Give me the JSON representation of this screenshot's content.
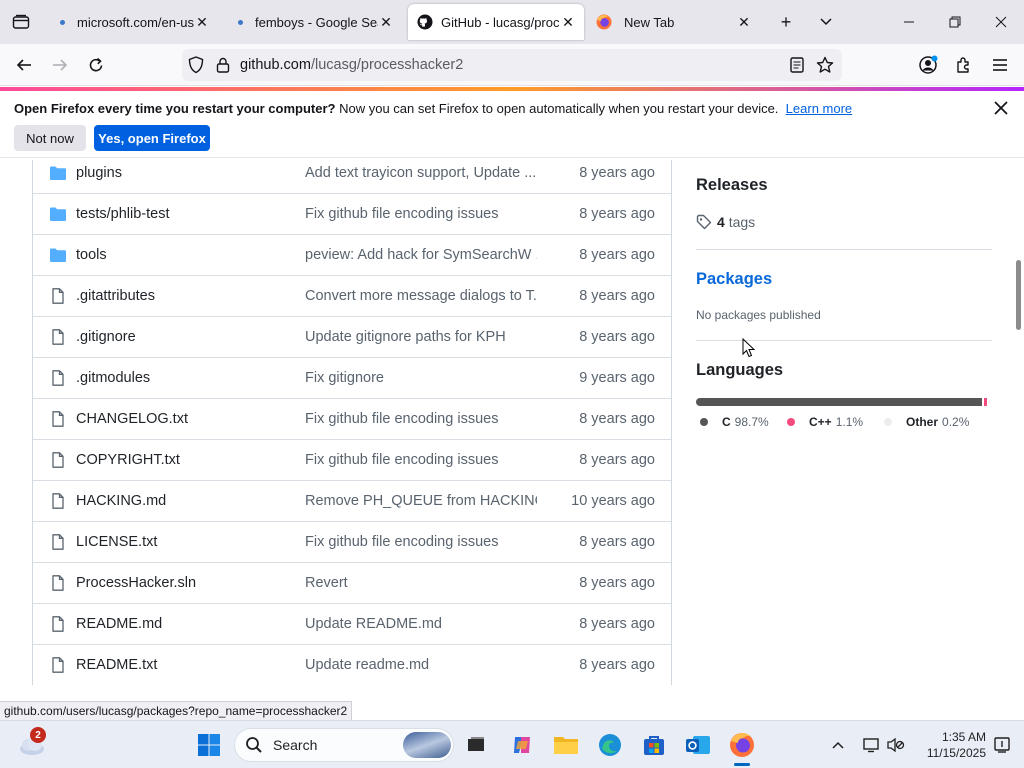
{
  "browser": {
    "tabs": [
      {
        "title": "microsoft.com/en-us/s",
        "active": false,
        "has_dot": true
      },
      {
        "title": "femboys - Google Sear",
        "active": false,
        "has_dot": true
      },
      {
        "title": "GitHub - lucasg/proces",
        "active": true,
        "icon": "github-icon"
      },
      {
        "title": "New Tab",
        "active": false,
        "icon": "firefox-icon"
      }
    ],
    "url_host": "github.com",
    "url_path": "/lucasg/processhacker2"
  },
  "notification": {
    "bold_text": "Open Firefox every time you restart your computer?",
    "text": " Now you can set Firefox to open automatically when you restart your device.",
    "link": "Learn more",
    "not_now": "Not now",
    "yes": "Yes, open Firefox"
  },
  "files": [
    {
      "type": "folder",
      "name": "plugins",
      "message": "Add text trayicon support, Update ...",
      "age": "8 years ago"
    },
    {
      "type": "folder",
      "name": "tests/phlib-test",
      "message": "Fix github file encoding issues",
      "age": "8 years ago"
    },
    {
      "type": "folder",
      "name": "tools",
      "message": "peview: Add hack for SymSearchW ...",
      "age": "8 years ago"
    },
    {
      "type": "file",
      "name": ".gitattributes",
      "message": "Convert more message dialogs to T...",
      "age": "8 years ago"
    },
    {
      "type": "file",
      "name": ".gitignore",
      "message": "Update gitignore paths for KPH",
      "age": "8 years ago"
    },
    {
      "type": "file",
      "name": ".gitmodules",
      "message": "Fix gitignore",
      "age": "9 years ago"
    },
    {
      "type": "file",
      "name": "CHANGELOG.txt",
      "message": "Fix github file encoding issues",
      "age": "8 years ago"
    },
    {
      "type": "file",
      "name": "COPYRIGHT.txt",
      "message": "Fix github file encoding issues",
      "age": "8 years ago"
    },
    {
      "type": "file",
      "name": "HACKING.md",
      "message": "Remove PH_QUEUE from HACKING....",
      "age": "10 years ago"
    },
    {
      "type": "file",
      "name": "LICENSE.txt",
      "message": "Fix github file encoding issues",
      "age": "8 years ago"
    },
    {
      "type": "file",
      "name": "ProcessHacker.sln",
      "message": "Revert",
      "age": "8 years ago"
    },
    {
      "type": "file",
      "name": "README.md",
      "message": "Update README.md",
      "age": "8 years ago"
    },
    {
      "type": "file",
      "name": "README.txt",
      "message": "Update readme.md",
      "age": "8 years ago"
    }
  ],
  "sidebar": {
    "releases_title": "Releases",
    "tags_count": "4",
    "tags_label": "tags",
    "packages_title": "Packages",
    "packages_text": "No packages published",
    "languages_title": "Languages",
    "languages": [
      {
        "name": "C",
        "percent": "98.7%",
        "value": 98.7,
        "color": "#555555"
      },
      {
        "name": "C++",
        "percent": "1.1%",
        "value": 1.1,
        "color": "#f34b7d"
      },
      {
        "name": "Other",
        "percent": "0.2%",
        "value": 0.2,
        "color": "#ededed"
      }
    ]
  },
  "status_url": "github.com/users/lucasg/packages?repo_name=processhacker2",
  "taskbar": {
    "notification_count": "2",
    "search_label": "Search",
    "time": "1:35 AM",
    "date": "11/15/2025"
  }
}
